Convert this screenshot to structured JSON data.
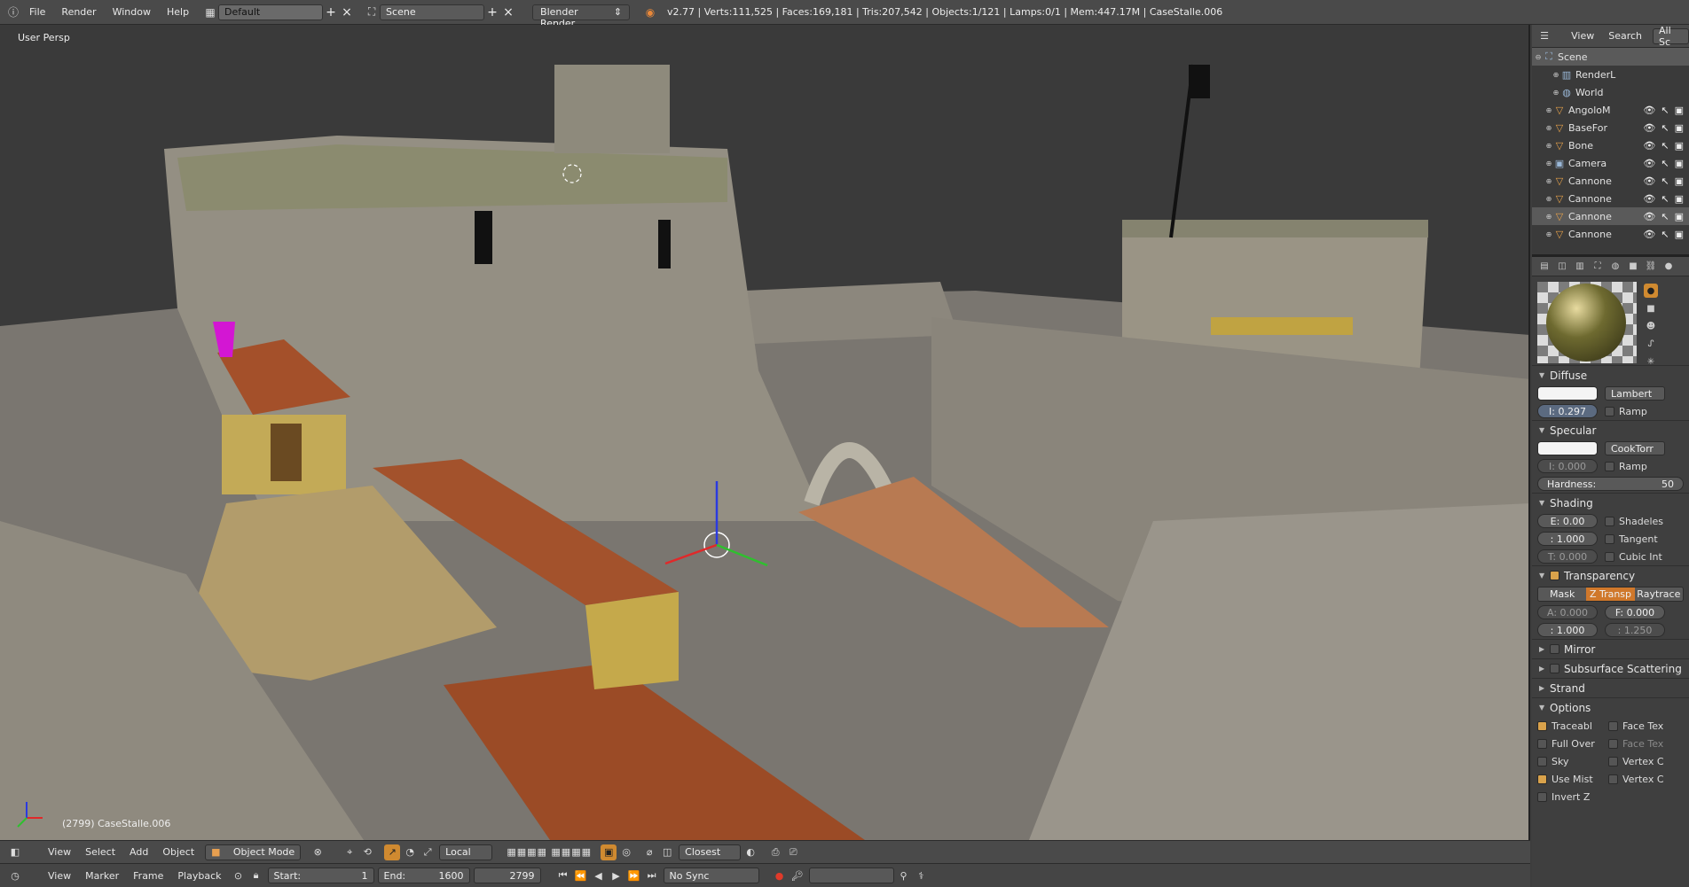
{
  "topbar": {
    "menus": [
      "File",
      "Render",
      "Window",
      "Help"
    ],
    "layout": "Default",
    "scene": "Scene",
    "engine": "Blender Render",
    "stats": "v2.77 | Verts:111,525 | Faces:169,181 | Tris:207,542 | Objects:1/121 | Lamps:0/1 | Mem:447.17M | CaseStalle.006"
  },
  "viewport": {
    "label": "User Persp",
    "object_info": "(2799) CaseStalle.006"
  },
  "view_header": {
    "menus": [
      "View",
      "Select",
      "Add",
      "Object"
    ],
    "mode": "Object Mode",
    "orientation": "Local",
    "snap": "Closest"
  },
  "timeline": {
    "menus": [
      "View",
      "Marker",
      "Frame",
      "Playback"
    ],
    "start_label": "Start:",
    "start": "1",
    "end_label": "End:",
    "end": "1600",
    "current": "2799",
    "sync": "No Sync"
  },
  "outliner": {
    "menus": [
      "View",
      "Search",
      "All Sc"
    ],
    "items": [
      {
        "name": "Scene",
        "icon": "scene-icon",
        "selected": true
      },
      {
        "name": "RenderL",
        "icon": "render-layers-icon"
      },
      {
        "name": "World",
        "icon": "world-icon"
      },
      {
        "name": "AngoloM",
        "icon": "mesh-icon"
      },
      {
        "name": "BaseFor",
        "icon": "mesh-icon"
      },
      {
        "name": "Bone",
        "icon": "mesh-icon"
      },
      {
        "name": "Camera",
        "icon": "camera-icon"
      },
      {
        "name": "Cannone",
        "icon": "mesh-icon"
      },
      {
        "name": "Cannone",
        "icon": "mesh-icon"
      },
      {
        "name": "Cannone",
        "icon": "mesh-icon",
        "selected": true
      },
      {
        "name": "Cannone",
        "icon": "mesh-icon"
      }
    ]
  },
  "props": {
    "diffuse": {
      "title": "Diffuse",
      "shader": "Lambert",
      "intensity": "I: 0.297",
      "ramp": "Ramp"
    },
    "specular": {
      "title": "Specular",
      "shader": "CookTorr",
      "intensity": "I: 0.000",
      "ramp": "Ramp",
      "hardness_label": "Hardness:",
      "hardness": "50"
    },
    "shading": {
      "title": "Shading",
      "emit": "E: 0.00",
      "ambient": ": 1.000",
      "translucency": "T: 0.000",
      "shadeless": "Shadeles",
      "tangent": "Tangent",
      "cubic": "Cubic Int"
    },
    "transparency": {
      "title": "Transparency",
      "modes": [
        "Mask",
        "Z Transp",
        "Raytrace"
      ],
      "alpha": "A: 0.000",
      "fresnel": "F: 0.000",
      "spec": ": 1.000",
      "blend": ": 1.250"
    },
    "mirror": {
      "title": "Mirror"
    },
    "sss": {
      "title": "Subsurface Scattering"
    },
    "strand": {
      "title": "Strand"
    },
    "options": {
      "title": "Options",
      "traceable": "Traceabl",
      "face_tex": "Face Tex",
      "full_over": "Full Over",
      "face_tex2": "Face Tex",
      "sky": "Sky",
      "vertex_c": "Vertex C",
      "use_mist": "Use Mist",
      "vertex_c2": "Vertex C",
      "invert_z": "Invert Z"
    }
  },
  "colors": {
    "accent": "#d0782b",
    "panel": "#3f3f3f",
    "header": "#4a4a4a"
  }
}
